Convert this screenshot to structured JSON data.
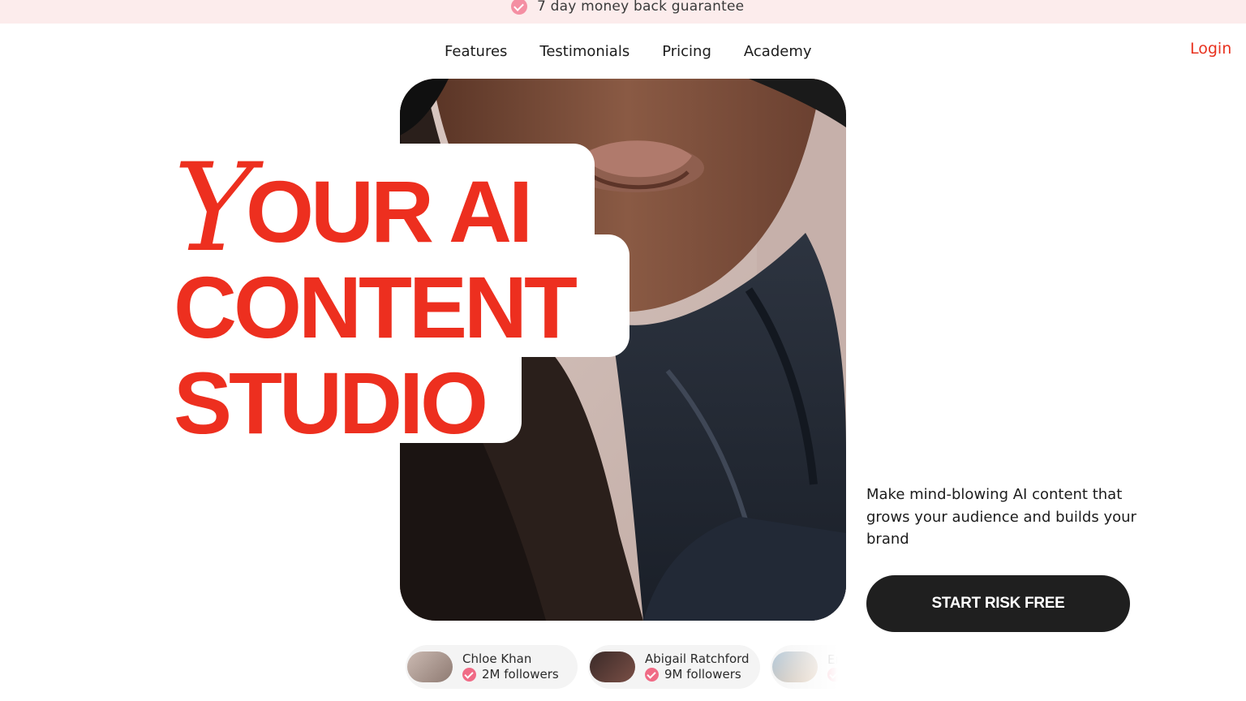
{
  "topbar": {
    "icon": "check-badge-icon",
    "text": "7 day money back guarantee"
  },
  "nav": {
    "items": [
      "Features",
      "Testimonials",
      "Pricing",
      "Academy"
    ],
    "login": "Login"
  },
  "hero": {
    "headline_script": "Y",
    "headline_line1": "OUR AI",
    "headline_line2": "CONTENT",
    "headline_line3": "STUDIO",
    "tagline": "Make mind-blowing AI content that grows your audience and builds your brand",
    "cta": "START RISK FREE"
  },
  "creators": [
    {
      "name": "Chloe Khan",
      "followers": "2M followers"
    },
    {
      "name": "Abigail Ratchford",
      "followers": "9M followers"
    },
    {
      "name": "Em",
      "followers": ""
    }
  ],
  "colors": {
    "accent": "#ed2f1f",
    "topbar_bg": "#fcecec",
    "cta_bg": "#1f1f1f",
    "badge": "#f06b86"
  }
}
